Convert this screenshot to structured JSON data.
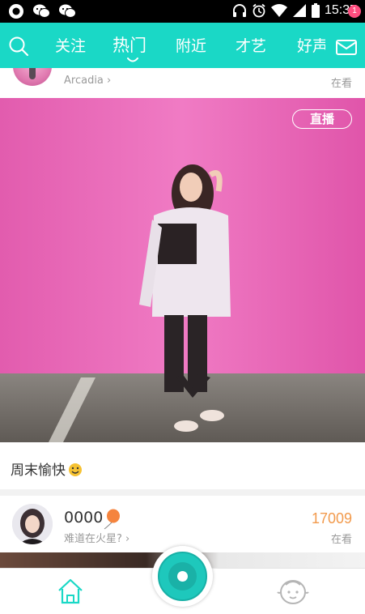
{
  "status_bar": {
    "time": "15:37",
    "left_icons": [
      "record-icon",
      "wechat-icon",
      "wechat-icon"
    ],
    "right_icons": [
      "headphones-icon",
      "alarm-icon",
      "wifi-icon",
      "signal-icon",
      "battery-icon"
    ]
  },
  "top_nav": {
    "tabs": [
      {
        "label": "关注",
        "active": false
      },
      {
        "label": "热门",
        "active": true
      },
      {
        "label": "附近",
        "active": false
      },
      {
        "label": "才艺",
        "active": false
      },
      {
        "label": "好声",
        "active": false
      }
    ],
    "mail_badge": "1"
  },
  "feed": {
    "card1": {
      "subtext": "Arcadia",
      "watching": "在看",
      "live_badge": "直播",
      "caption": "周末愉快"
    },
    "card2": {
      "name": "0000",
      "subtext": "难道在火星?",
      "viewer_count": "17009",
      "watching": "在看"
    }
  },
  "colors": {
    "accent": "#1ad8c6",
    "badge": "#ff4d7f",
    "count": "#f29a4c",
    "live_bg": "#e858b0"
  }
}
